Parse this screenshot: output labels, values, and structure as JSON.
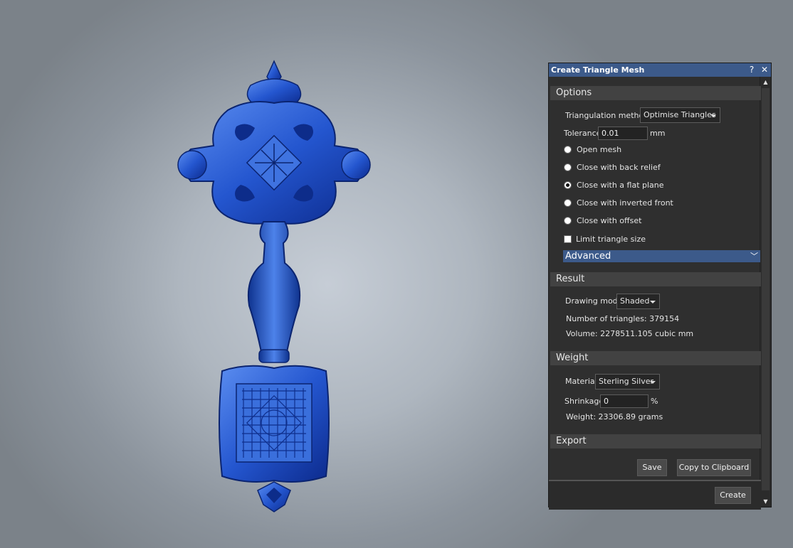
{
  "dialog": {
    "title": "Create Triangle Mesh",
    "help_label": "?",
    "close_label": "✕"
  },
  "options": {
    "header": "Options",
    "triangulation_label": "Triangulation method",
    "triangulation_value": "Optimise Triangles",
    "tolerance_label": "Tolerance",
    "tolerance_value": "0.01",
    "tolerance_unit": "mm",
    "close_options": [
      {
        "label": "Open mesh",
        "selected": false
      },
      {
        "label": "Close with back relief",
        "selected": false
      },
      {
        "label": "Close with a flat plane",
        "selected": true
      },
      {
        "label": "Close with inverted front",
        "selected": false
      },
      {
        "label": "Close with offset",
        "selected": false
      }
    ],
    "limit_label": "Limit triangle size",
    "limit_checked": false,
    "advanced_label": "Advanced"
  },
  "result": {
    "header": "Result",
    "drawing_mode_label": "Drawing mode",
    "drawing_mode_value": "Shaded",
    "triangles_text": "Number of triangles: 379154",
    "volume_text": "Volume: 2278511.105 cubic mm"
  },
  "weight": {
    "header": "Weight",
    "material_label": "Material",
    "material_value": "Sterling Silver",
    "shrinkage_label": "Shrinkage",
    "shrinkage_value": "0",
    "shrinkage_unit": "%",
    "weight_text": "Weight: 23306.89 grams"
  },
  "export": {
    "header": "Export",
    "save_label": "Save",
    "copy_label": "Copy to Clipboard"
  },
  "footer": {
    "create_label": "Create"
  },
  "colors": {
    "accent": "#3c5a8a",
    "panel_bg": "#2f2f2f",
    "model_blue": "#1e50c8"
  }
}
